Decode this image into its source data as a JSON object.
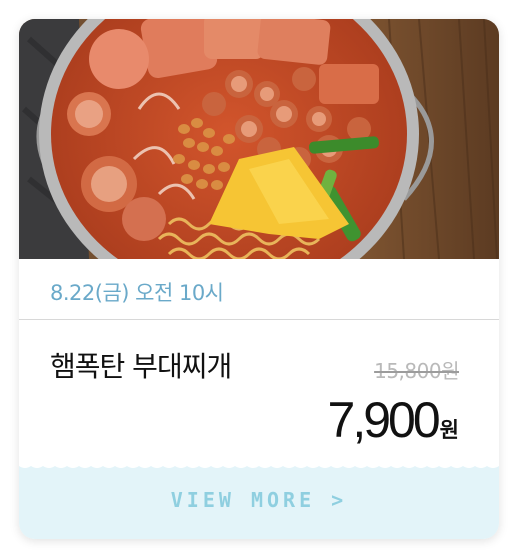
{
  "product": {
    "image_alt": "햄폭탄 부대찌개 사진",
    "date": "8.22(금) 오전 10시",
    "name": "햄폭탄 부대찌개",
    "original_price": "15,800원",
    "price": "7,900",
    "currency": "원"
  },
  "action": {
    "label": "VIEW MORE >"
  },
  "colors": {
    "date": "#6aa9c9",
    "more_bg": "#e3f4f9",
    "more_text": "#8fcfe0"
  }
}
